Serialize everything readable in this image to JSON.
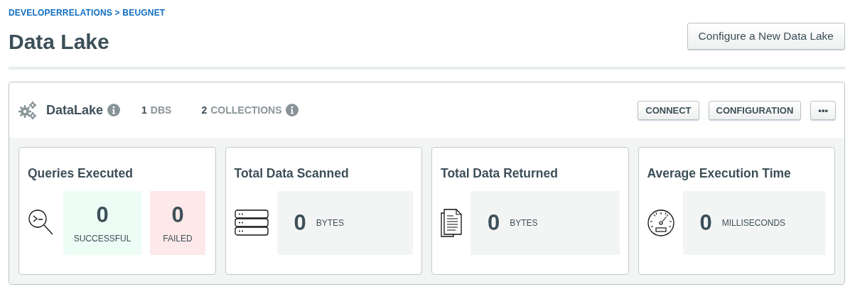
{
  "breadcrumb": "DEVELOPERRELATIONS > BEUGNET",
  "title": "Data Lake",
  "primary_button": "Configure a New Data Lake",
  "lake": {
    "name": "DataLake",
    "stats": [
      {
        "value": "1",
        "label": "DBS",
        "info": false
      },
      {
        "value": "2",
        "label": "COLLECTIONS",
        "info": true
      }
    ],
    "actions": [
      {
        "label": "CONNECT"
      },
      {
        "label": "CONFIGURATION"
      },
      {
        "label": "•••"
      }
    ],
    "cards": [
      {
        "title": "Queries Executed",
        "kind": "split",
        "tiles": [
          {
            "value": "0",
            "unit": "SUCCESSFUL",
            "kind": "success"
          },
          {
            "value": "0",
            "unit": "FAILED",
            "kind": "failure"
          }
        ]
      },
      {
        "title": "Total Data Scanned",
        "kind": "single",
        "tiles": [
          {
            "value": "0",
            "unit": "BYTES",
            "kind": "neutral"
          }
        ]
      },
      {
        "title": "Total Data Returned",
        "kind": "single",
        "tiles": [
          {
            "value": "0",
            "unit": "BYTES",
            "kind": "neutral"
          }
        ]
      },
      {
        "title": "Average Execution Time",
        "kind": "single",
        "tiles": [
          {
            "value": "0",
            "unit": "MILLISECONDS",
            "kind": "neutral"
          }
        ]
      }
    ]
  }
}
